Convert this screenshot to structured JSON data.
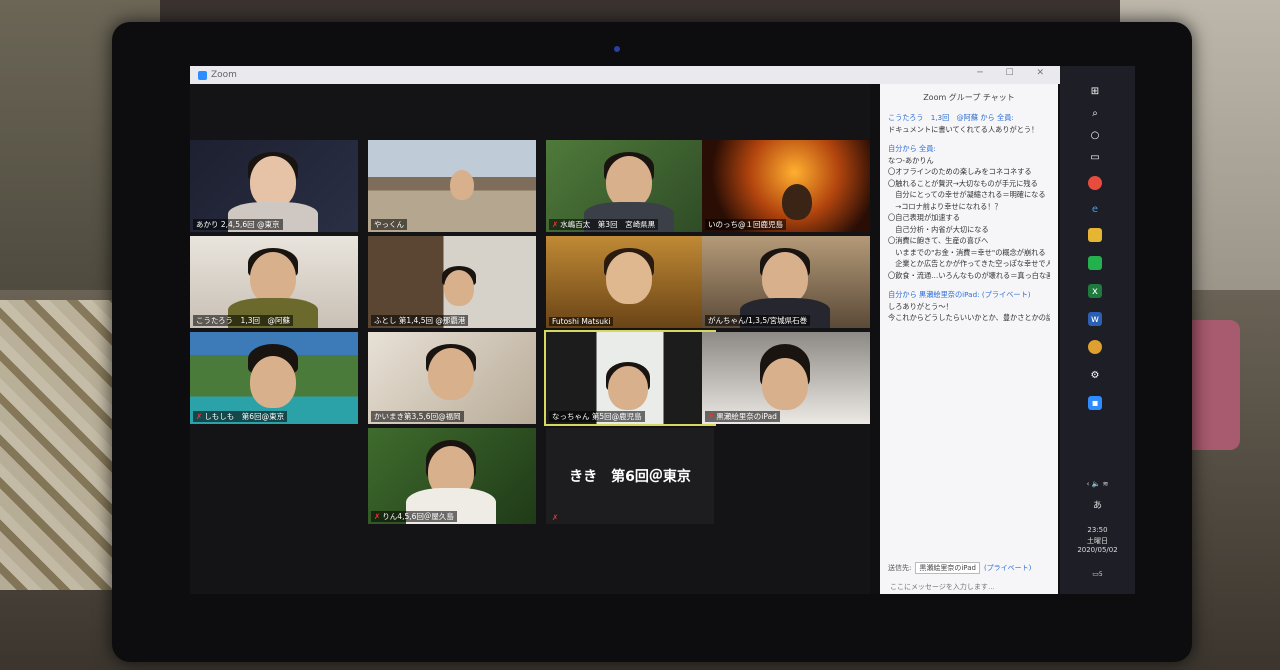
{
  "window": {
    "title": "Zoom"
  },
  "participants": [
    {
      "name": "あかり 2,4,5,6回 @東京",
      "muted": false
    },
    {
      "name": "やっくん",
      "muted": false
    },
    {
      "name": "水嶋百太　第3回　宮崎県黒",
      "muted": true
    },
    {
      "name": "いのっち@１回鹿児島",
      "muted": false
    },
    {
      "name": "こうたろう　1,3回　@阿蘇",
      "muted": false
    },
    {
      "name": "ふとし 第1,4,5回 @那覇港",
      "muted": false
    },
    {
      "name": "Futoshi Matsuki",
      "muted": false
    },
    {
      "name": "がんちゃん/1,3,5/宮城県石巻",
      "muted": false
    },
    {
      "name": "しもしも　第6回@東京",
      "muted": true
    },
    {
      "name": "かいまき第3,5,6回@福岡",
      "muted": false
    },
    {
      "name": "なっちゃん 第5回@鹿児島",
      "muted": false
    },
    {
      "name": "黒瀬絵里奈のiPad",
      "muted": true
    },
    {
      "name": "りん4,5,6回＠屋久島",
      "muted": true
    },
    {
      "name": "きき　第6回＠東京",
      "muted": true,
      "video_off": true
    }
  ],
  "chat": {
    "title": "Zoom グループ チャット",
    "msg1_header": "こうたろう　1,3回　@阿蘇 から 全員:",
    "msg1_text": "ドキュメントに書いてくれてる人ありがとう！",
    "msg2_header": "自分から 全員:",
    "msg2_lines": [
      "なつ-あかりん",
      "〇オフラインのための楽しみをコネコネする",
      "〇触れることが贅沢→大切なものが手元に残る",
      "　自分にとっての幸せが凝縮される＝明確になる",
      "　→コロナ前より幸せになれる！？",
      "〇自己表現が加速する",
      "　自己分析・内省が大切になる",
      "〇消費に飽きて、生産の喜びへ",
      "　いままでの\"お金・消費＝幸せ\"の概念が崩れる",
      "　企業とか広告とかが作ってきた空っぽな幸せで人々を騙せなくなった",
      "〇飲食・流通…いろんなものが壊れる＝真っ白な画用紙を渡される。「私たちの世代が世界を作っていく」が確実になった。たのしみ〜😊"
    ],
    "msg3_header": "自分から 黒瀬絵里奈のiPad: (プライベート)",
    "msg3_lines": [
      "しろありがとう〜！",
      "今これからどうしたらいいかとか、豊かさとかの話をしてる。"
    ],
    "send_to_label": "送信先:",
    "send_to_value": "黒瀬絵里奈のiPad",
    "private_label": "(プライベート)",
    "input_placeholder": "ここにメッセージを入力します…"
  },
  "taskbar": {
    "ime": "あ",
    "time": "23:50",
    "day": "土曜日",
    "date": "2020/05/02",
    "notifications": "5"
  }
}
